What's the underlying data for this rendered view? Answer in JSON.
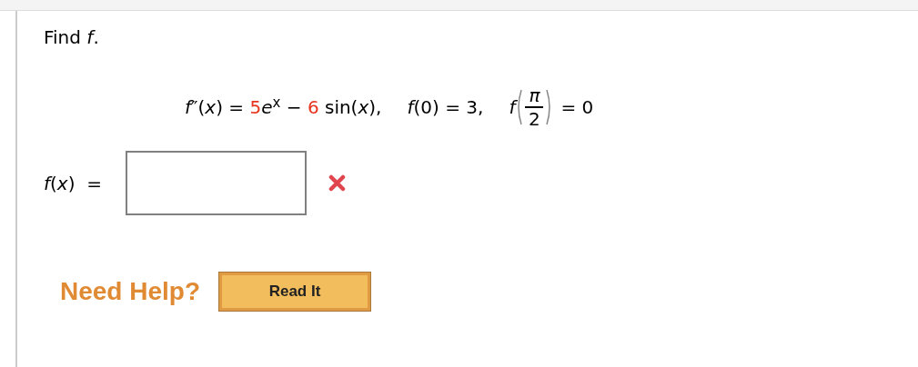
{
  "prompt": "Find *f*.",
  "equation": {
    "parts": [
      {
        "kind": "plain",
        "text": "*f*″(*x*) = "
      },
      {
        "kind": "coef",
        "text": "5"
      },
      {
        "kind": "plain",
        "text": "*e*$^{x}$ − "
      },
      {
        "kind": "coef",
        "text": "6"
      },
      {
        "kind": "plain",
        "text": " sin(*x*),"
      }
    ]
  },
  "condition_1": "*f*(0) = 3,",
  "condition_2": {
    "func": "*f*",
    "numerator": "π",
    "denominator": "2",
    "rhs": "= 0"
  },
  "answer": {
    "label": "*f*(*x*)  =",
    "incorrect": true
  },
  "help": {
    "label": "Need Help?",
    "buttons": [
      "Read It"
    ]
  }
}
